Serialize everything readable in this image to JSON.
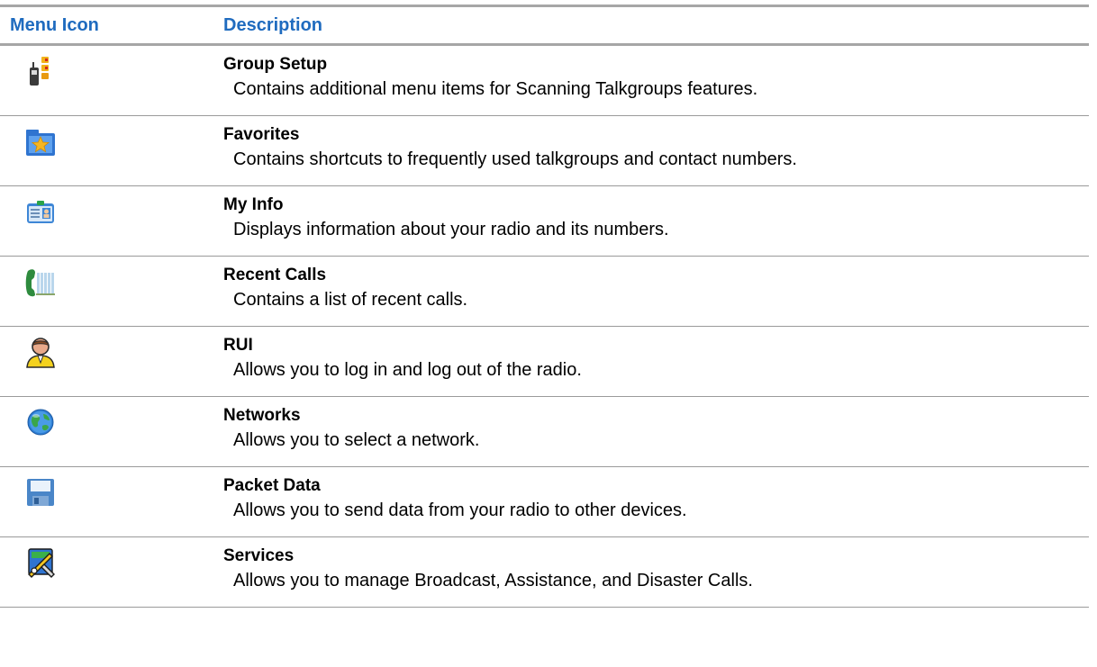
{
  "header": {
    "col_icon": "Menu Icon",
    "col_description": "Description"
  },
  "rows": [
    {
      "icon": "group-setup-icon",
      "name": "Group Setup",
      "description": "Contains additional menu items for Scanning Talkgroups features."
    },
    {
      "icon": "favorites-star-folder-icon",
      "name": "Favorites",
      "description": "Contains shortcuts to frequently used talkgroups and contact numbers."
    },
    {
      "icon": "id-card-icon",
      "name": "My Info",
      "description": "Displays information about your radio and its numbers."
    },
    {
      "icon": "phone-call-log-icon",
      "name": "Recent Calls",
      "description": "Contains a list of recent calls."
    },
    {
      "icon": "user-person-icon",
      "name": "RUI",
      "description": "Allows you to log in and log out of the radio."
    },
    {
      "icon": "globe-icon",
      "name": "Networks",
      "description": "Allows you to select a network."
    },
    {
      "icon": "floppy-disk-icon",
      "name": "Packet Data",
      "description": "Allows you to send data from your radio to other devices."
    },
    {
      "icon": "tools-wrench-icon",
      "name": "Services",
      "description": "Allows you to manage Broadcast, Assistance, and Disaster Calls."
    }
  ],
  "colors": {
    "header_text": "#1f6bbf",
    "rule": "#a6a6a6"
  }
}
